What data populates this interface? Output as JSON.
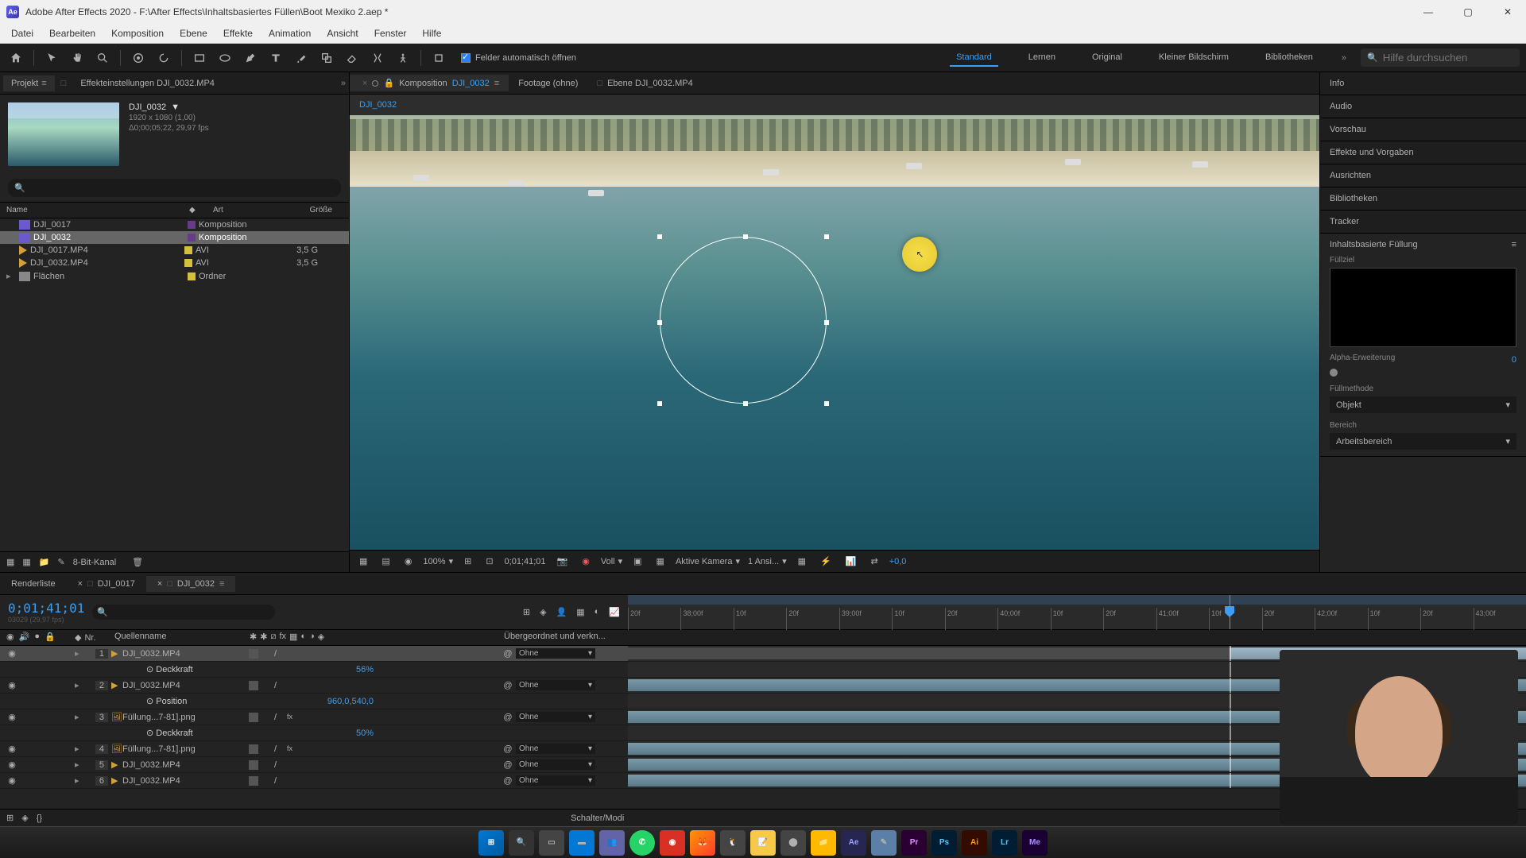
{
  "window": {
    "app_abbrev": "Ae",
    "title": "Adobe After Effects 2020 - F:\\After Effects\\Inhaltsbasiertes Füllen\\Boot Mexiko 2.aep *"
  },
  "menus": [
    "Datei",
    "Bearbeiten",
    "Komposition",
    "Ebene",
    "Effekte",
    "Animation",
    "Ansicht",
    "Fenster",
    "Hilfe"
  ],
  "toolbar": {
    "auto_open_fields": "Felder automatisch öffnen",
    "workspaces": [
      "Standard",
      "Lernen",
      "Original",
      "Kleiner Bildschirm",
      "Bibliotheken"
    ],
    "active_workspace": "Standard",
    "search_placeholder": "Hilfe durchsuchen"
  },
  "project_panel": {
    "tabs": {
      "projekt": "Projekt",
      "effekt": "Effekteinstellungen DJI_0032.MP4"
    },
    "comp_name": "DJI_0032",
    "resolution": "1920 x 1080 (1,00)",
    "duration": "Δ0;00;05;22, 29,97 fps",
    "headers": {
      "name": "Name",
      "art": "Art",
      "size": "Größe"
    },
    "items": [
      {
        "name": "DJI_0017",
        "type": "Komposition",
        "icon": "comp",
        "chip": "#6a3a8a",
        "size": ""
      },
      {
        "name": "DJI_0032",
        "type": "Komposition",
        "icon": "comp",
        "chip": "#6a3a8a",
        "size": "",
        "selected": true
      },
      {
        "name": "DJI_0017.MP4",
        "type": "AVI",
        "icon": "avi",
        "chip": "#d4c03a",
        "size": "3,5 G"
      },
      {
        "name": "DJI_0032.MP4",
        "type": "AVI",
        "icon": "avi",
        "chip": "#d4c03a",
        "size": "3,5 G"
      },
      {
        "name": "Flächen",
        "type": "Ordner",
        "icon": "folder",
        "chip": "#d4c03a",
        "size": "",
        "expandable": true
      }
    ],
    "bitdepth": "8-Bit-Kanal"
  },
  "comp_viewer": {
    "tabs": {
      "komposition": "Komposition",
      "komposition_name": "DJI_0032",
      "footage": "Footage  (ohne)",
      "ebene": "Ebene  DJI_0032.MP4"
    },
    "breadcrumb": "DJI_0032",
    "footer": {
      "zoom": "100%",
      "timecode": "0;01;41;01",
      "resolution": "Voll",
      "camera": "Aktive Kamera",
      "views": "1 Ansi...",
      "exposure": "+0,0"
    }
  },
  "right_panels": {
    "items": [
      "Info",
      "Audio",
      "Vorschau",
      "Effekte und Vorgaben",
      "Ausrichten",
      "Bibliotheken",
      "Tracker"
    ],
    "caf": {
      "title": "Inhaltsbasierte Füllung",
      "fill_target": "Füllziel",
      "alpha_label": "Alpha-Erweiterung",
      "alpha_value": "0",
      "method_label": "Füllmethode",
      "method_value": "Objekt",
      "range_label": "Bereich",
      "range_value": "Arbeitsbereich"
    }
  },
  "timeline": {
    "tabs": {
      "render": "Renderliste",
      "comp1": "DJI_0017",
      "comp2": "DJI_0032"
    },
    "timecode": "0;01;41;01",
    "subtime": "03029 (29,97 fps)",
    "ruler": [
      "20f",
      "38;00f",
      "10f",
      "20f",
      "39;00f",
      "10f",
      "20f",
      "40;00f",
      "10f",
      "20f",
      "41;00f",
      "10f",
      "20f",
      "42;00f",
      "10f",
      "20f",
      "43;00f"
    ],
    "col_headers": {
      "nr": "Nr.",
      "quelle": "Quellenname",
      "parent": "Übergeordnet und verkn..."
    },
    "parent_none": "Ohne",
    "deckkraft": "Deckkraft",
    "position": "Position",
    "layers": [
      {
        "idx": "1",
        "name": "DJI_0032.MP4",
        "icon": "avi",
        "selected": true,
        "props": [
          {
            "name": "Deckkraft",
            "value": "56%"
          }
        ]
      },
      {
        "idx": "2",
        "name": "DJI_0032.MP4",
        "icon": "avi",
        "props": [
          {
            "name": "Position",
            "value": "960,0,540,0"
          }
        ]
      },
      {
        "idx": "3",
        "name": "Füllung...7-81].png",
        "icon": "fx",
        "props": [
          {
            "name": "Deckkraft",
            "value": "50%"
          }
        ]
      },
      {
        "idx": "4",
        "name": "Füllung...7-81].png",
        "icon": "fx"
      },
      {
        "idx": "5",
        "name": "DJI_0032.MP4",
        "icon": "avi"
      },
      {
        "idx": "6",
        "name": "DJI_0032.MP4",
        "icon": "avi"
      }
    ],
    "footer_toggle": "Schalter/Modi"
  }
}
